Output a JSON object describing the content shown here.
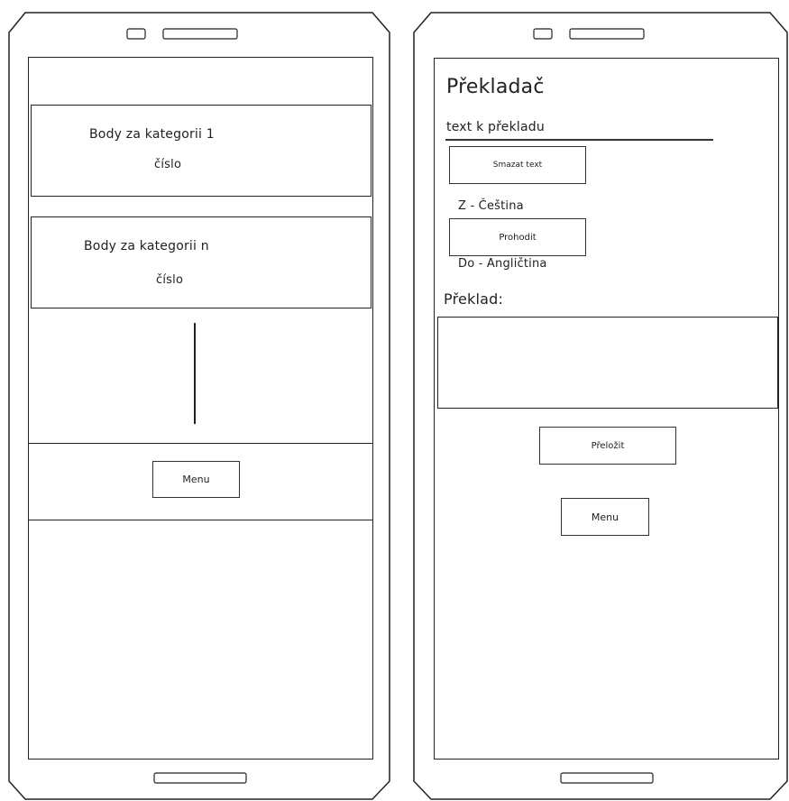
{
  "left_phone": {
    "cards": [
      {
        "title": "Body za kategorii 1",
        "value": "číslo"
      },
      {
        "title": "Body za kategorii n",
        "value": "číslo"
      }
    ],
    "menu_label": "Menu"
  },
  "right_phone": {
    "title": "Překladač",
    "input_placeholder": "text k překladu",
    "clear_label": "Smazat text",
    "from_label": "Z - Čeština",
    "swap_label": "Prohodit",
    "to_label": "Do - Angličtina",
    "result_label": "Překlad:",
    "translate_label": "Přeložit",
    "menu_label": "Menu"
  }
}
